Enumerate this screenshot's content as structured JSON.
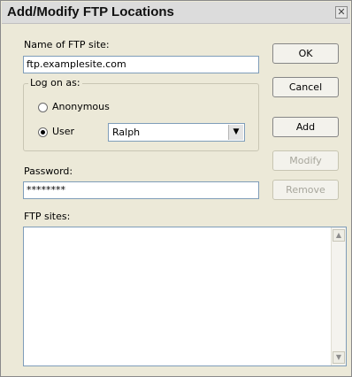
{
  "window": {
    "title": "Add/Modify FTP Locations"
  },
  "form": {
    "name_label": "Name of FTP site:",
    "name_value": "ftp.examplesite.com",
    "logon_label": "Log on as:",
    "anonymous_label": "Anonymous",
    "user_label": "User",
    "user_value": "Ralph",
    "password_label": "Password:",
    "password_value": "********",
    "sites_label": "FTP sites:"
  },
  "buttons": {
    "ok": "OK",
    "cancel": "Cancel",
    "add": "Add",
    "modify": "Modify",
    "remove": "Remove"
  },
  "state": {
    "selected_logon": "User"
  },
  "icons": {
    "close": "close-icon",
    "dropdown": "chevron-down-icon",
    "scroll_up": "scroll-up-arrow-icon",
    "scroll_down": "scroll-down-arrow-icon"
  }
}
